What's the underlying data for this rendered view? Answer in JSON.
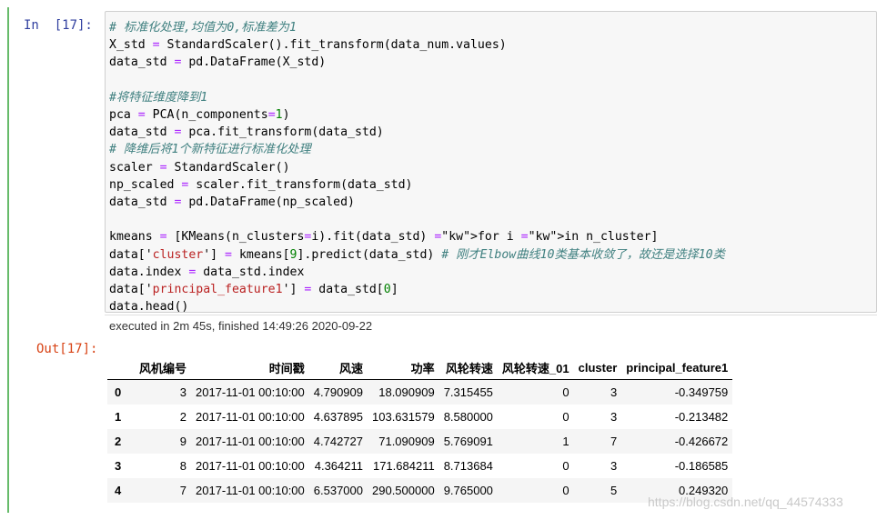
{
  "cell": {
    "in_prompt": "In  [17]:",
    "out_prompt": "Out[17]:",
    "code": {
      "l1": "# 标准化处理,均值为0,标准差为1",
      "l2": "X_std = StandardScaler().fit_transform(data_num.values)",
      "l3": "data_std = pd.DataFrame(X_std)",
      "l5": "#将特征维度降到1",
      "l6": "pca = PCA(n_components=1)",
      "l7": "data_std = pca.fit_transform(data_std)",
      "l8": "# 降维后将1个新特征进行标准化处理",
      "l9": "scaler = StandardScaler()",
      "l10": "np_scaled = scaler.fit_transform(data_std)",
      "l11": "data_std = pd.DataFrame(np_scaled)",
      "l13": "kmeans = [KMeans(n_clusters=i).fit(data_std) for i in n_cluster]",
      "l14": "data['cluster'] = kmeans[9].predict(data_std) # 刚才Elbow曲线10类基本收敛了，故还是选择10类",
      "l15": "data.index = data_std.index",
      "l16": "data['principal_feature1'] = data_std[0]",
      "l17": "data.head()"
    },
    "execution_info": "executed in 2m 45s, finished 14:49:26 2020-09-22"
  },
  "output_table": {
    "columns": [
      "",
      "风机编号",
      "时间戳",
      "风速",
      "功率",
      "风轮转速",
      "风轮转速_01",
      "cluster",
      "principal_feature1"
    ],
    "rows": [
      [
        "0",
        "3",
        "2017-11-01 00:10:00",
        "4.790909",
        "18.090909",
        "7.315455",
        "0",
        "3",
        "-0.349759"
      ],
      [
        "1",
        "2",
        "2017-11-01 00:10:00",
        "4.637895",
        "103.631579",
        "8.580000",
        "0",
        "3",
        "-0.213482"
      ],
      [
        "2",
        "9",
        "2017-11-01 00:10:00",
        "4.742727",
        "71.090909",
        "5.769091",
        "1",
        "7",
        "-0.426672"
      ],
      [
        "3",
        "8",
        "2017-11-01 00:10:00",
        "4.364211",
        "171.684211",
        "8.713684",
        "0",
        "3",
        "-0.186585"
      ],
      [
        "4",
        "7",
        "2017-11-01 00:10:00",
        "6.537000",
        "290.500000",
        "9.765000",
        "0",
        "5",
        "0.249320"
      ]
    ]
  },
  "watermark": "https://blog.csdn.net/qq_44574333",
  "colors": {
    "cell_border": "#66bb6a",
    "in_prompt": "#303f9f",
    "out_prompt": "#d84315",
    "comment": "#408080",
    "keyword": "#008000",
    "string": "#ba2121",
    "operator": "#aa22ff"
  }
}
